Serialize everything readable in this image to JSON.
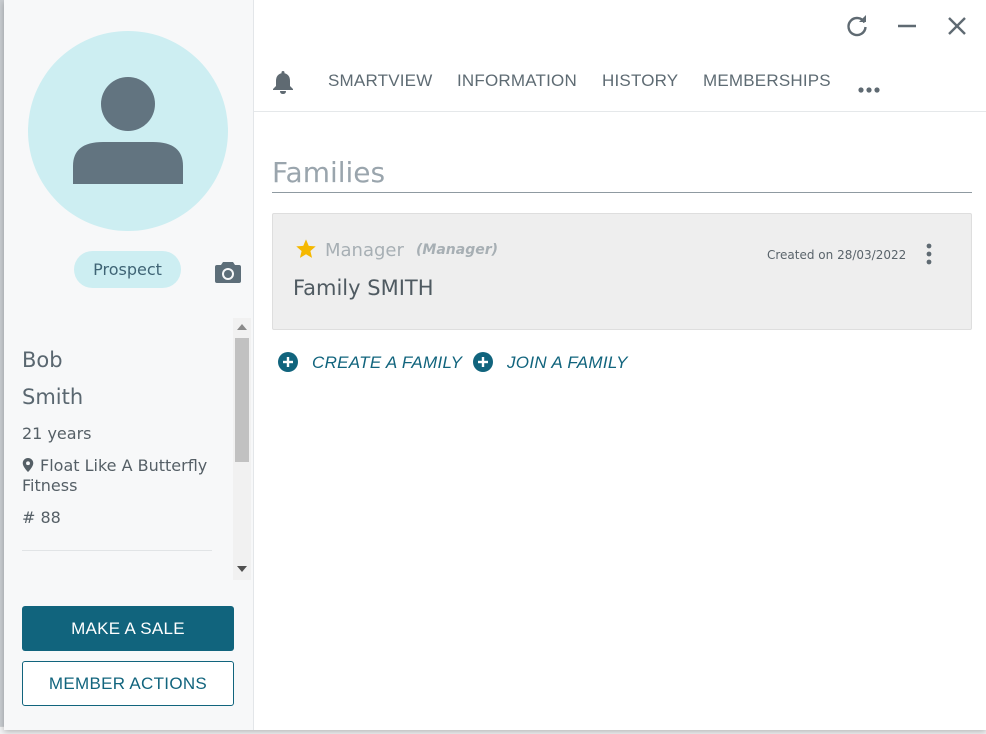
{
  "window": {
    "controls": {
      "refresh_icon": "refresh-icon",
      "minimize_icon": "minimize-icon",
      "close_icon": "close-icon"
    }
  },
  "member": {
    "status": "Prospect",
    "first_name": "Bob",
    "last_name": "Smith",
    "age": "21 years",
    "location": "Float Like A Butterfly Fitness",
    "member_id": "# 88"
  },
  "actions": {
    "make_sale": "MAKE A SALE",
    "member_actions": "MEMBER ACTIONS"
  },
  "tabs": [
    {
      "label": "SMARTVIEW"
    },
    {
      "label": "INFORMATION"
    },
    {
      "label": "HISTORY"
    },
    {
      "label": "MEMBERSHIPS"
    }
  ],
  "families": {
    "title": "Families",
    "cards": [
      {
        "role": "Manager",
        "role_detail": "(Manager)",
        "created": "Created on 28/03/2022",
        "name": "Family SMITH"
      }
    ],
    "create_label": "CREATE A FAMILY",
    "join_label": "JOIN A FAMILY"
  },
  "colors": {
    "primary": "#11647d",
    "avatar_bg": "#cdeef2",
    "star": "#f5b800",
    "card_bg": "#eeeeee"
  }
}
